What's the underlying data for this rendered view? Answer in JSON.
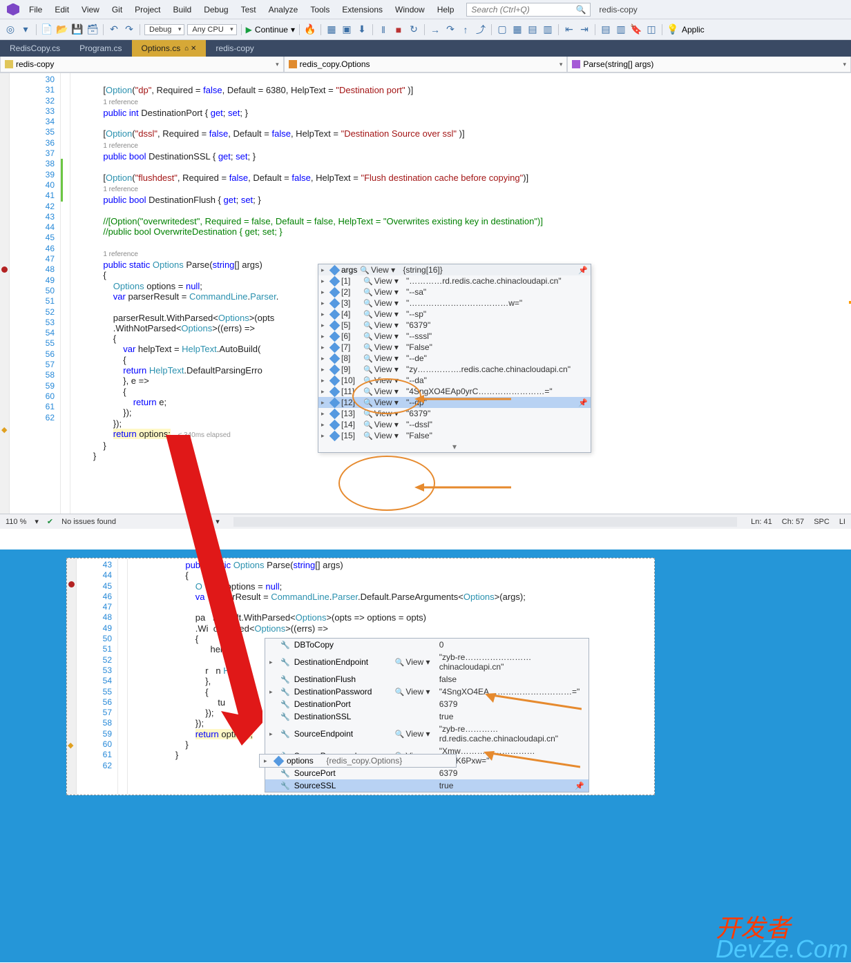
{
  "menubar": {
    "items": [
      "File",
      "Edit",
      "View",
      "Git",
      "Project",
      "Build",
      "Debug",
      "Test",
      "Analyze",
      "Tools",
      "Extensions",
      "Window",
      "Help"
    ],
    "search_placeholder": "Search (Ctrl+Q)",
    "solution": "redis-copy"
  },
  "toolbar": {
    "config": "Debug",
    "platform": "Any CPU",
    "continue": "Continue",
    "applic": "Applic"
  },
  "tabs": [
    {
      "label": "RedisCopy.cs",
      "active": false
    },
    {
      "label": "Program.cs",
      "active": false
    },
    {
      "label": "Options.cs",
      "active": true
    },
    {
      "label": "redis-copy",
      "active": false
    }
  ],
  "nav": {
    "project": "redis-copy",
    "class": "redis_copy.Options",
    "member": "Parse(string[] args)"
  },
  "code_lines": [
    {
      "n": 30,
      "t": "            "
    },
    {
      "n": 31,
      "t": "            [<span class='attr'>Option</span>(<span class='str'>\"dp\"</span>, Required = <span class='kw'>false</span>, Default = 6380, HelpText = <span class='str'>\"Destination port\"</span> )]"
    },
    {
      "n": "",
      "t": "            <span class='ref'>1 reference</span>"
    },
    {
      "n": 32,
      "t": "            <span class='kw'>public int</span> DestinationPort { <span class='kw'>get</span>; <span class='kw'>set</span>; }"
    },
    {
      "n": 33,
      "t": ""
    },
    {
      "n": 34,
      "t": "            [<span class='attr'>Option</span>(<span class='str'>\"dssl\"</span>, Required = <span class='kw'>false</span>, Default = <span class='kw'>false</span>, HelpText = <span class='str'>\"Destination Source over ssl\"</span> )]"
    },
    {
      "n": "",
      "t": "            <span class='ref'>1 reference</span>"
    },
    {
      "n": 35,
      "t": "            <span class='kw'>public bool</span> DestinationSSL { <span class='kw'>get</span>; <span class='kw'>set</span>; }"
    },
    {
      "n": 36,
      "t": ""
    },
    {
      "n": 37,
      "t": "            [<span class='attr'>Option</span>(<span class='str'>\"flushdest\"</span>, Required = <span class='kw'>false</span>, Default = <span class='kw'>false</span>, HelpText = <span class='str'>\"Flush destination cache before copying\"</span>)]"
    },
    {
      "n": "",
      "t": "            <span class='ref'>1 reference</span>"
    },
    {
      "n": 38,
      "t": "            <span class='kw'>public bool</span> DestinationFlush { <span class='kw'>get</span>; <span class='kw'>set</span>; }"
    },
    {
      "n": 39,
      "t": ""
    },
    {
      "n": 40,
      "t": "            <span class='cm'>//[Option(\"overwritedest\", Required = false, Default = false, HelpText = \"Overwrites existing key in destination\")]</span>"
    },
    {
      "n": 41,
      "t": "            <span class='cm'>//public bool OverwriteDestination { get; set; }</span>"
    },
    {
      "n": 42,
      "t": ""
    },
    {
      "n": "",
      "t": "            <span class='ref'>1 reference</span>"
    },
    {
      "n": 43,
      "t": "            <span class='kw'>public static</span> <span class='type'>Options</span> Parse(<span class='kw'>string</span>[] args)"
    },
    {
      "n": 44,
      "t": "            {"
    },
    {
      "n": 45,
      "t": "                <span class='type'>Options</span> options = <span class='kw'>null</span>;"
    },
    {
      "n": 46,
      "t": "                <span class='kw'>var</span> parserResult = <span class='type'>CommandLine</span>.<span class='type'>Parser</span>."
    },
    {
      "n": 47,
      "t": ""
    },
    {
      "n": 48,
      "t": "                parserResult.WithParsed&lt;<span class='type'>Options</span>&gt;(opts"
    },
    {
      "n": 49,
      "t": "                .WithNotParsed&lt;<span class='type'>Options</span>&gt;((errs) =&gt;"
    },
    {
      "n": 50,
      "t": "                {"
    },
    {
      "n": 51,
      "t": "                    <span class='kw'>var</span> helpText = <span class='type'>HelpText</span>.AutoBuild("
    },
    {
      "n": 52,
      "t": "                    {"
    },
    {
      "n": 53,
      "t": "                    <span class='kw'>return</span> <span class='type'>HelpText</span>.DefaultParsingErro"
    },
    {
      "n": 54,
      "t": "                    }, e =&gt;"
    },
    {
      "n": 55,
      "t": "                    {"
    },
    {
      "n": 56,
      "t": "                        <span class='kw'>return</span> e;"
    },
    {
      "n": 57,
      "t": "                    });"
    },
    {
      "n": 58,
      "t": "                });"
    },
    {
      "n": 59,
      "t": "                <span class='hl'><span class='kw'>return</span> options;</span>   <span class='elapsed'>≤ 340ms elapsed</span>"
    },
    {
      "n": 60,
      "t": "            }"
    },
    {
      "n": 61,
      "t": "        }"
    },
    {
      "n": 62,
      "t": ""
    }
  ],
  "datatip1": {
    "header": {
      "name": "args",
      "type": "{string[16]}"
    },
    "rows": [
      {
        "i": "[1]",
        "v": "\"…………rd.redis.cache.chinacloudapi.cn\""
      },
      {
        "i": "[2]",
        "v": "\"--sa\""
      },
      {
        "i": "[3]",
        "v": "\"………………………………w=\""
      },
      {
        "i": "[4]",
        "v": "\"--sp\""
      },
      {
        "i": "[5]",
        "v": "\"6379\""
      },
      {
        "i": "[6]",
        "v": "\"--sssl\""
      },
      {
        "i": "[7]",
        "v": "\"False\""
      },
      {
        "i": "[8]",
        "v": "\"--de\""
      },
      {
        "i": "[9]",
        "v": "\"zy…………….redis.cache.chinacloudapi.cn\""
      },
      {
        "i": "[10]",
        "v": "\"--da\""
      },
      {
        "i": "[11]",
        "v": "\"4SngXO4EAp0yrC……………………=\""
      },
      {
        "i": "[12]",
        "v": "\"--dp\"",
        "sel": true
      },
      {
        "i": "[13]",
        "v": "\"6379\""
      },
      {
        "i": "[14]",
        "v": "\"--dssl\""
      },
      {
        "i": "[15]",
        "v": "\"False\""
      }
    ]
  },
  "status": {
    "zoom": "110 %",
    "issues": "No issues found",
    "ln": "Ln: 41",
    "ch": "Ch: 57",
    "mode": "SPC"
  },
  "code2": [
    {
      "n": 43,
      "t": "            <span class='kw'>publ</span>   <span class='kw'>static</span> <span class='type'>Options</span> Parse(<span class='kw'>string</span>[] args)"
    },
    {
      "n": 44,
      "t": "            {"
    },
    {
      "n": 45,
      "t": "                <span class='type'>O</span>  <span class='type'>ions</span> options = <span class='kw'>null</span>;"
    },
    {
      "n": 46,
      "t": "                <span class='kw'>va</span>  parserResult = <span class='type'>CommandLine</span>.<span class='type'>Parser</span>.Default.ParseArguments&lt;<span class='type'>Options</span>&gt;(args);"
    },
    {
      "n": 47,
      "t": ""
    },
    {
      "n": 48,
      "t": "                pa   rResult.WithParsed&lt;<span class='type'>Options</span>&gt;(opts =&gt; options = opts)"
    },
    {
      "n": 49,
      "t": "                .Wi  otParsed&lt;<span class='type'>Options</span>&gt;((errs) =&gt;"
    },
    {
      "n": 50,
      "t": "                {"
    },
    {
      "n": 51,
      "t": "                      helpTe"
    },
    {
      "n": 52,
      "t": "                    "
    },
    {
      "n": 53,
      "t": "                    r   n <span class='type'>Hel</span>"
    },
    {
      "n": 54,
      "t": "                    },  "
    },
    {
      "n": 55,
      "t": "                    {"
    },
    {
      "n": 56,
      "t": "                         tu"
    },
    {
      "n": 57,
      "t": "                    });"
    },
    {
      "n": 58,
      "t": "                });"
    },
    {
      "n": 59,
      "t": "                <span class='hl'><span class='kw'>return</span> options;</span>"
    },
    {
      "n": 60,
      "t": "            }"
    },
    {
      "n": 61,
      "t": "        }"
    },
    {
      "n": 62,
      "t": ""
    }
  ],
  "loc": {
    "rows": [
      {
        "name": "DBToCopy",
        "v": "0"
      },
      {
        "name": "DestinationEndpoint",
        "v": "\"zyb-re……………………chinacloudapi.cn\"",
        "q": true
      },
      {
        "name": "DestinationFlush",
        "v": "false"
      },
      {
        "name": "DestinationPassword",
        "v": "\"4SngXO4EA…………………………=\"",
        "q": true
      },
      {
        "name": "DestinationPort",
        "v": "6379"
      },
      {
        "name": "DestinationSSL",
        "v": "true"
      },
      {
        "name": "SourceEndpoint",
        "v": "\"zyb-re…………rd.redis.cache.chinacloudapi.cn\"",
        "q": true
      },
      {
        "name": "SourcePassword",
        "v": "\"Xmw………………………CoCK6Pxw=\"",
        "q": true
      },
      {
        "name": "SourcePort",
        "v": "6379"
      },
      {
        "name": "SourceSSL",
        "v": "true",
        "sel": true
      }
    ],
    "footer": {
      "name": "options",
      "type": "{redis_copy.Options}"
    }
  },
  "watermark": {
    "l1": "开发者",
    "l2": "DevZe.Com"
  }
}
